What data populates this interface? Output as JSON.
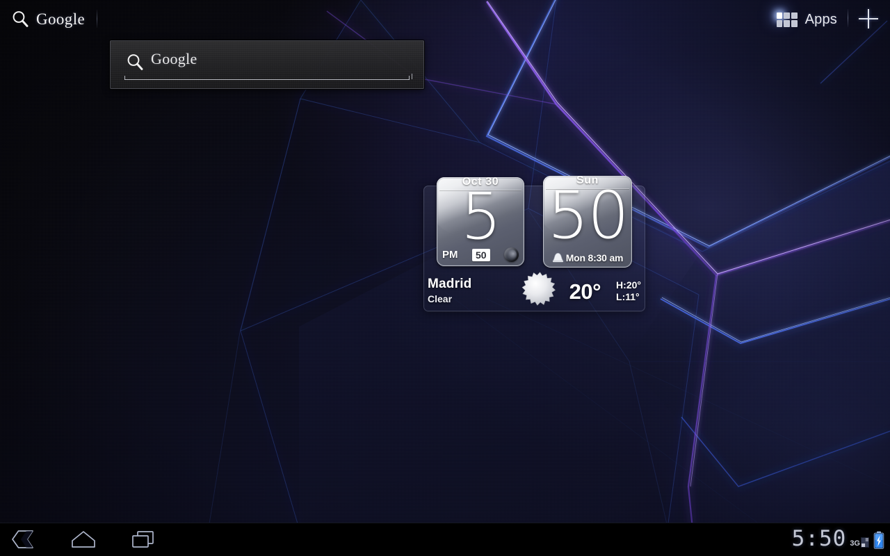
{
  "top_bar": {
    "google_search_label": "Google",
    "google_icon": "search-magnifier-icon",
    "apps_label": "Apps",
    "apps_icon": "apps-grid-icon",
    "add_icon": "plus-icon"
  },
  "search_widget": {
    "icon": "search-magnifier-icon",
    "placeholder": "Google",
    "value": ""
  },
  "clock_weather_widget": {
    "clock_card": {
      "date_label": "Oct  30",
      "hour": "5",
      "meridiem": "PM",
      "minutes": "50",
      "icon": "moon-icon"
    },
    "alarm_card": {
      "day_label": "Sun",
      "day_number": "50",
      "alarm_icon": "alarm-bell-icon",
      "alarm_time": "Mon 8:30 am"
    },
    "weather": {
      "city": "Madrid",
      "condition": "Clear",
      "condition_icon": "sun-icon",
      "temperature": "20°",
      "high": "H:20°",
      "low": "L:11°"
    }
  },
  "system_bar": {
    "nav": [
      {
        "name": "back-button",
        "icon": "back-chevron-icon"
      },
      {
        "name": "home-button",
        "icon": "home-icon"
      },
      {
        "name": "recents-button",
        "icon": "recent-apps-icon"
      }
    ],
    "clock": "5:50",
    "network_label": "3G",
    "network_icon": "signal-bars-icon",
    "battery_icon": "battery-charging-icon"
  },
  "colors": {
    "accent_blue": "#4a6fff",
    "accent_purple": "#7a4ddd",
    "wallpaper_base": "#04040c",
    "battery_blue": "#2f86f0",
    "text_primary": "#ffffff",
    "status_text": "#c3c7d4"
  }
}
